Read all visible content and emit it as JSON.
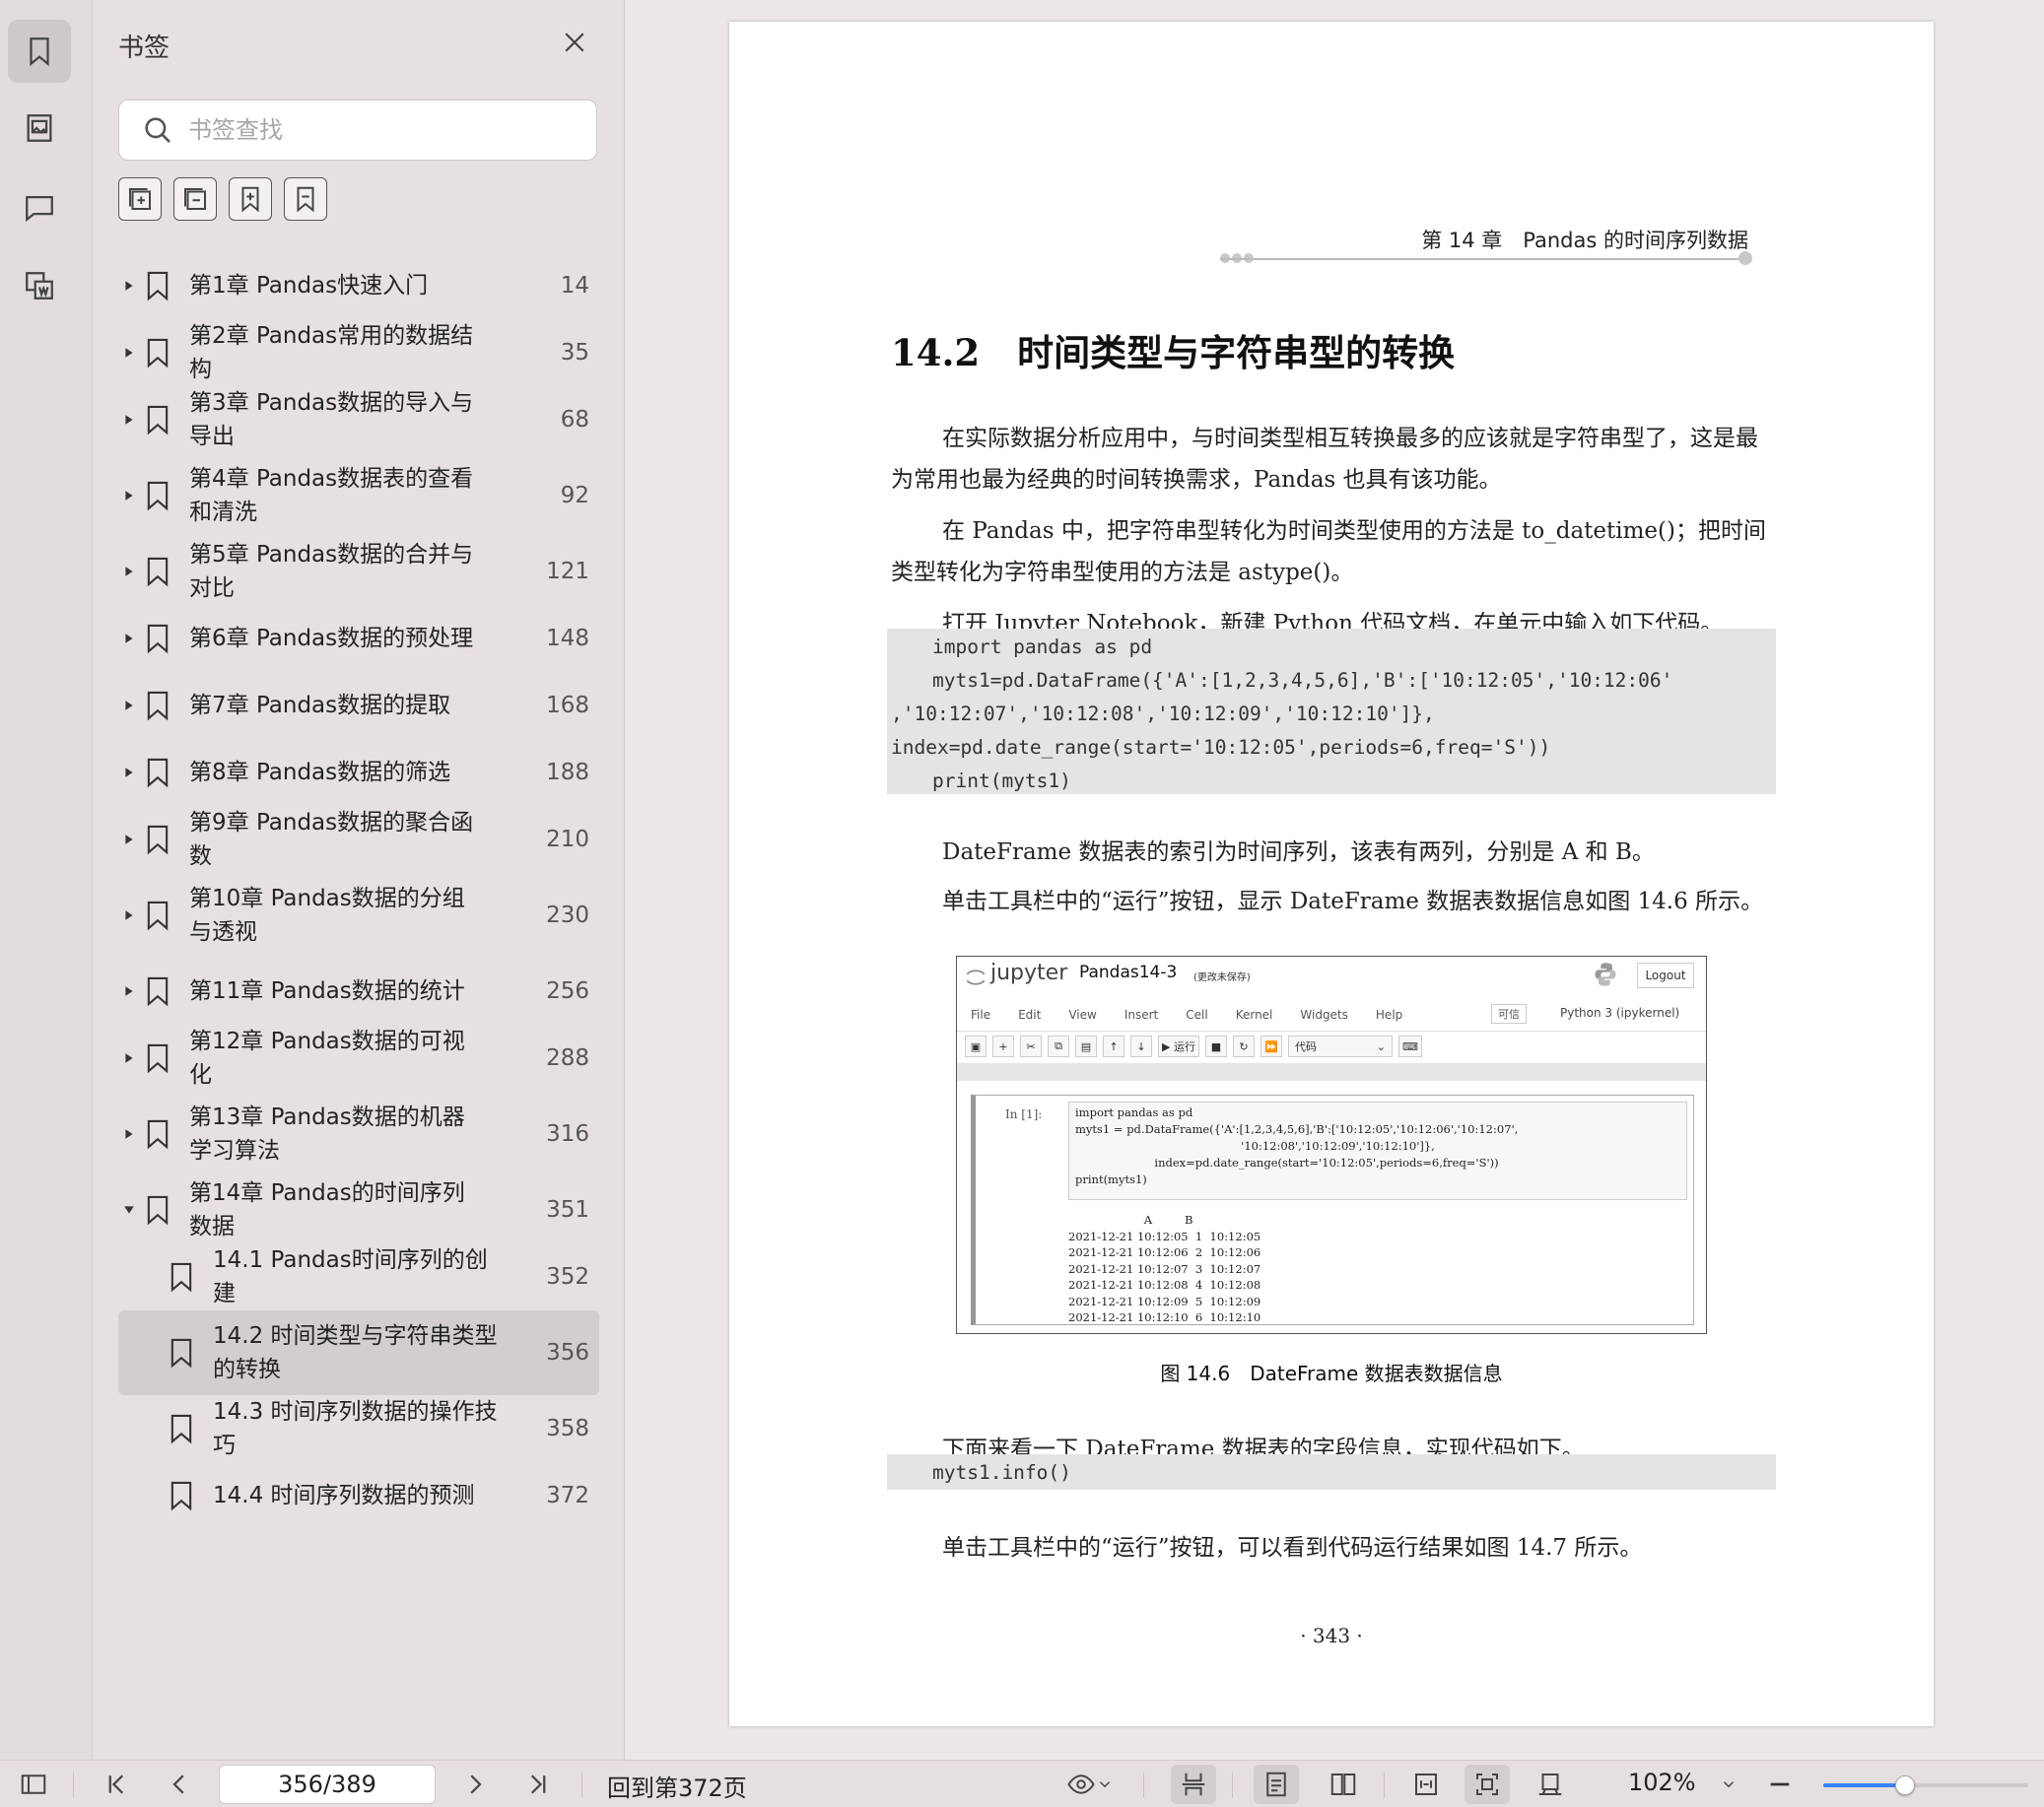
{
  "sidebar_panel": {
    "title": "书签",
    "search_placeholder": "书签查找",
    "bookmarks": [
      {
        "label": "第1章 Pandas快速入门",
        "page": "14",
        "expanded": false
      },
      {
        "label": "第2章 Pandas常用的数据结构",
        "page": "35",
        "expanded": false
      },
      {
        "label": "第3章 Pandas数据的导入与导出",
        "page": "68",
        "expanded": false
      },
      {
        "label": "第4章 Pandas数据表的查看和清洗",
        "page": "92",
        "expanded": false
      },
      {
        "label": "第5章 Pandas数据的合并与对比",
        "page": "121",
        "expanded": false
      },
      {
        "label": "第6章 Pandas数据的预处理",
        "page": "148",
        "expanded": false
      },
      {
        "label": "第7章 Pandas数据的提取",
        "page": "168",
        "expanded": false
      },
      {
        "label": "第8章 Pandas数据的筛选",
        "page": "188",
        "expanded": false
      },
      {
        "label": "第9章 Pandas数据的聚合函数",
        "page": "210",
        "expanded": false
      },
      {
        "label": "第10章 Pandas数据的分组与透视",
        "page": "230",
        "expanded": false
      },
      {
        "label": "第11章 Pandas数据的统计",
        "page": "256",
        "expanded": false
      },
      {
        "label": "第12章 Pandas数据的可视化",
        "page": "288",
        "expanded": false
      },
      {
        "label": "第13章 Pandas数据的机器学习算法",
        "page": "316",
        "expanded": false
      },
      {
        "label": "第14章 Pandas的时间序列数据",
        "page": "351",
        "expanded": true
      },
      {
        "label": "14.1 Pandas时间序列的创建",
        "page": "352",
        "child": true
      },
      {
        "label": "14.2 时间类型与字符串类型的转换",
        "page": "356",
        "child": true,
        "selected": true
      },
      {
        "label": "14.3 时间序列数据的操作技巧",
        "page": "358",
        "child": true
      },
      {
        "label": "14.4 时间序列数据的预测",
        "page": "372",
        "child": true
      }
    ]
  },
  "document": {
    "running_head": "第 14 章　Pandas 的时间序列数据",
    "section_number": "14.2",
    "section_title": "时间类型与字符串型的转换",
    "para1": "在实际数据分析应用中，与时间类型相互转换最多的应该就是字符串型了，这是最为常用也最为经典的时间转换需求，Pandas 也具有该功能。",
    "para2": "在 Pandas 中，把字符串型转化为时间类型使用的方法是 to_datetime()；把时间类型转化为字符串型使用的方法是 astype()。",
    "para3": "打开 Jupyter Notebook，新建 Python 代码文档，在单元中输入如下代码。",
    "code1": [
      "import pandas as pd",
      "myts1=pd.DataFrame({'A':[1,2,3,4,5,6],'B':['10:12:05','10:12:06'",
      ",'10:12:07','10:12:08','10:12:09','10:12:10']},",
      "index=pd.date_range(start='10:12:05',periods=6,freq='S'))",
      "print(myts1)"
    ],
    "para4": "DateFrame 数据表的索引为时间序列，该表有两列，分别是 A 和 B。",
    "para5": "单击工具栏中的“运行”按钮，显示 DateFrame 数据表数据信息如图 14.6 所示。",
    "figure": {
      "logo_text": "jupyter",
      "notebook_name": "Pandas14-3",
      "notebook_status": "(更改未保存)",
      "logout": "Logout",
      "menus": [
        "File",
        "Edit",
        "View",
        "Insert",
        "Cell",
        "Kernel",
        "Widgets",
        "Help"
      ],
      "trusted": "可信",
      "kernel": "Python 3 (ipykernel)",
      "run_label": "▶ 运行",
      "cell_type": "代码",
      "prompt": "In  [1]:",
      "input_lines": [
        "import pandas as pd",
        "myts1 = pd.DataFrame({'A':[1,2,3,4,5,6],'B':['10:12:05','10:12:06','10:12:07',",
        "                                              '10:12:08','10:12:09','10:12:10']},",
        "                      index=pd.date_range(start='10:12:05',periods=6,freq='S'))",
        "print(myts1)"
      ],
      "output_lines": [
        "                     A         B",
        "2021-12-21 10:12:05  1  10:12:05",
        "2021-12-21 10:12:06  2  10:12:06",
        "2021-12-21 10:12:07  3  10:12:07",
        "2021-12-21 10:12:08  4  10:12:08",
        "2021-12-21 10:12:09  5  10:12:09",
        "2021-12-21 10:12:10  6  10:12:10"
      ]
    },
    "caption": "图 14.6　DateFrame 数据表数据信息",
    "para6": "下面来看一下 DateFrame 数据表的字段信息，实现代码如下。",
    "code2": [
      "myts1.info()"
    ],
    "para7": "单击工具栏中的“运行”按钮，可以看到代码运行结果如图 14.7 所示。",
    "page_number": "· 343 ·"
  },
  "statusbar": {
    "page_value": "356/389",
    "goto_label": "回到第372页",
    "zoom": "102%",
    "zoom_level": 0.4
  },
  "colors": {
    "accent": "#3a82f7",
    "selection": "#d4cdd0",
    "panel_bg": "#e7e0e3"
  }
}
